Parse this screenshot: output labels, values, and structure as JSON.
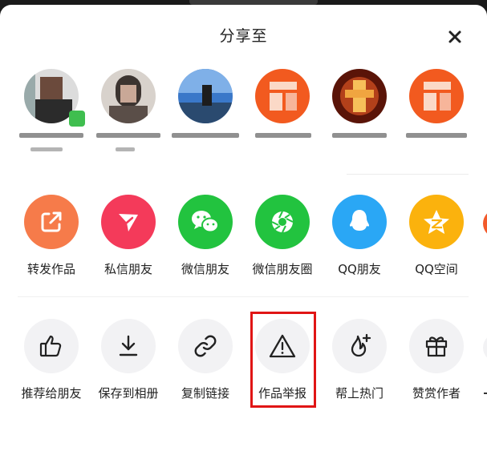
{
  "sheet": {
    "title": "分享至"
  },
  "contacts": [
    {
      "id": "c1"
    },
    {
      "id": "c2"
    },
    {
      "id": "c3"
    },
    {
      "id": "c4"
    },
    {
      "id": "c5"
    },
    {
      "id": "c6"
    }
  ],
  "share_targets": [
    {
      "label": "转发作品",
      "icon": "repost-icon",
      "color": "#f67b4a"
    },
    {
      "label": "私信朋友",
      "icon": "send-icon",
      "color": "#f43a5a"
    },
    {
      "label": "微信朋友",
      "icon": "wechat-icon",
      "color": "#22c33f"
    },
    {
      "label": "微信朋友圈",
      "icon": "moments-icon",
      "color": "#22c33f"
    },
    {
      "label": "QQ朋友",
      "icon": "qq-icon",
      "color": "#2aa7f5"
    },
    {
      "label": "QQ空间",
      "icon": "qzone-icon",
      "color": "#fbb20d"
    }
  ],
  "actions": [
    {
      "label": "推荐给朋友",
      "icon": "thumbs-up-icon"
    },
    {
      "label": "保存到相册",
      "icon": "download-icon"
    },
    {
      "label": "复制链接",
      "icon": "link-icon"
    },
    {
      "label": "作品举报",
      "icon": "warning-icon"
    },
    {
      "label": "帮上热门",
      "icon": "boost-flame-icon"
    },
    {
      "label": "赞赏作者",
      "icon": "gift-icon"
    }
  ],
  "colors": {
    "highlight": "#e01515",
    "action_bg": "#f2f2f4"
  }
}
